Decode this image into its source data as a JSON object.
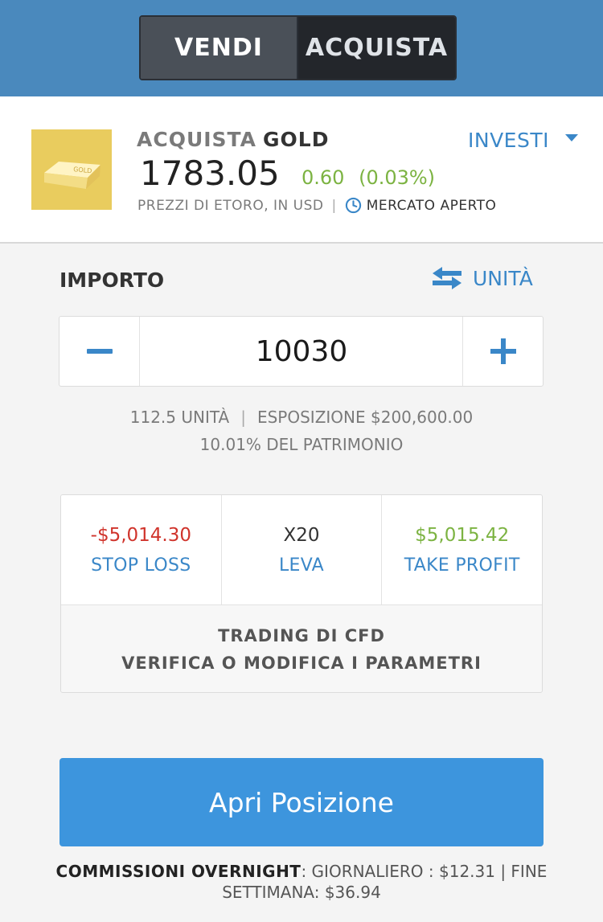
{
  "header": {
    "sell_label": "VENDI",
    "buy_label": "ACQUISTA"
  },
  "instrument": {
    "action": "ACQUISTA",
    "name": "GOLD",
    "logo_text": "GOLD",
    "price": "1783.05",
    "change": "0.60",
    "change_pct": "(0.03%)",
    "source": "PREZZI DI ETORO, IN USD",
    "market_status": "MERCATO APERTO",
    "invest_label": "INVESTI"
  },
  "amount": {
    "label": "IMPORTO",
    "units_toggle": "UNITÀ",
    "value": "10030",
    "units": "112.5 UNITÀ",
    "exposure": "ESPOSIZIONE $200,600.00",
    "equity": "10.01% DEL PATRIMONIO"
  },
  "params": {
    "stop_loss_value": "-$5,014.30",
    "stop_loss_label": "STOP LOSS",
    "leverage_value": "X20",
    "leverage_label": "LEVA",
    "take_profit_value": "$5,015.42",
    "take_profit_label": "TAKE PROFIT",
    "cfd_line1": "TRADING DI CFD",
    "cfd_line2": "VERIFICA O MODIFICA I PARAMETRI"
  },
  "open_button": "Apri Posizione",
  "overnight": {
    "label": "COMMISSIONI OVERNIGHT",
    "text": ": GIORNALIERO : $12.31  |  FINE SETTIMANA: $36.94"
  },
  "colors": {
    "header_bg": "#4a89bd",
    "accent": "#3a87c8",
    "primary_button": "#3d95dd",
    "positive": "#7cb342",
    "negative": "#d0342c",
    "gold": "#e9cc5e"
  },
  "icons": {
    "logo": "gold-bar-icon",
    "market": "clock-icon",
    "invest": "caret-down-icon",
    "units": "swap-arrows-icon",
    "decrease": "minus-icon",
    "increase": "plus-icon"
  }
}
